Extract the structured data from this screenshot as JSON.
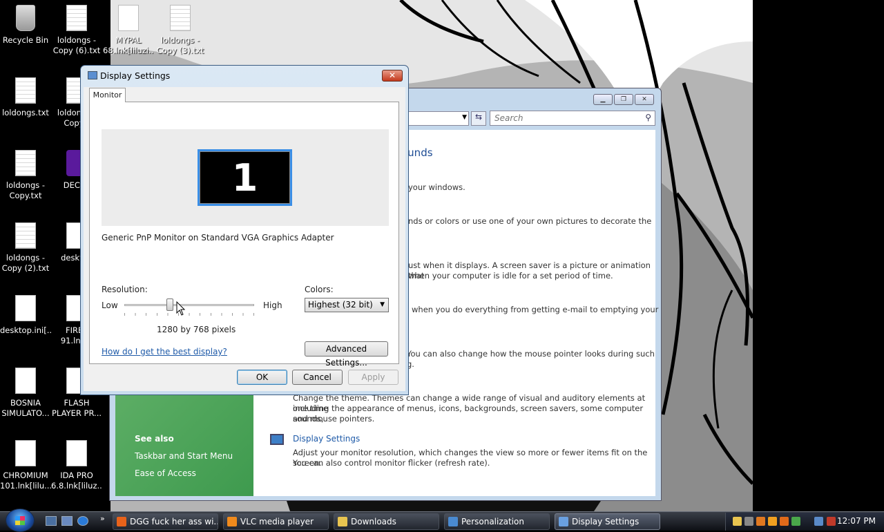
{
  "desktop_icons": [
    {
      "label": "Recycle Bin",
      "kind": "bin"
    },
    {
      "label": "loldongs - Copy (6).txt",
      "kind": "txt"
    },
    {
      "label": "MYPAL 68.lnk[liluzi...",
      "kind": "file"
    },
    {
      "label": "loldongs - Copy (3).txt",
      "kind": "txt"
    },
    {
      "label": "loldongs.txt",
      "kind": "txt"
    },
    {
      "label": "loldongs - Copy (",
      "kind": "txt"
    },
    {
      "label": "loldongs - Copy.txt",
      "kind": "txt"
    },
    {
      "label": "DECRY",
      "kind": "fox"
    },
    {
      "label": "loldongs - Copy (2).txt",
      "kind": "txt"
    },
    {
      "label": "desktop",
      "kind": "file"
    },
    {
      "label": "desktop.ini[...",
      "kind": "file"
    },
    {
      "label": "FIREF 91.lnk[li",
      "kind": "file"
    },
    {
      "label": "BOSNIA SIMULATO...",
      "kind": "file"
    },
    {
      "label": "FLASH PLAYER PR...",
      "kind": "file"
    },
    {
      "label": "CHROMIUM 101.lnk[lilu...",
      "kind": "file"
    },
    {
      "label": "IDA PRO 6.8.lnk[liluz...",
      "kind": "file"
    }
  ],
  "personalization": {
    "search_placeholder": "Search",
    "heading_fragment": "ounds",
    "lines": [
      "your windows.",
      "nds or colors or use one of your own pictures to decorate the",
      "ust when it displays. A screen saver is a picture or animation that",
      "when your computer is idle for a set period of time.",
      "when you do everything from getting e-mail to emptying your",
      "You can also change how the mouse pointer looks during such",
      "g.",
      "Change the theme. Themes can change a wide range of visual and auditory elements at one time",
      "including the appearance of menus, icons, backgrounds, screen savers, some computer sounds,",
      "and mouse pointers."
    ],
    "display_settings_link": "Display Settings",
    "display_settings_desc_1": "Adjust your monitor resolution, which changes the view so more or fewer items fit on the screen.",
    "display_settings_desc_2": "You can also control monitor flicker (refresh rate).",
    "see_also": "See also",
    "see_also_links": [
      "Taskbar and Start Menu",
      "Ease of Access"
    ]
  },
  "dialog": {
    "title": "Display Settings",
    "close_glyph": "✕",
    "tab": "Monitor",
    "monitor_number": "1",
    "adapter": "Generic PnP Monitor on Standard VGA Graphics Adapter",
    "resolution_label": "Resolution:",
    "low": "Low",
    "high": "High",
    "resolution_slider_fraction": 0.35,
    "resolution_text": "1280 by 768 pixels",
    "colors_label": "Colors:",
    "colors_value": "Highest (32 bit)",
    "help_link": "How do I get the best display?",
    "advanced_button": "Advanced Settings...",
    "ok": "OK",
    "cancel": "Cancel",
    "apply": "Apply"
  },
  "taskbar": {
    "tasks": [
      {
        "label": "DGG fuck her ass wi...",
        "color": "#e8621a"
      },
      {
        "label": "VLC media player",
        "color": "#f08a1c"
      },
      {
        "label": "Downloads",
        "color": "#e8c450"
      },
      {
        "label": "Personalization",
        "color": "#4a8ad0"
      },
      {
        "label": "Display Settings",
        "color": "#6aa0e0"
      }
    ],
    "more_glyph": "»",
    "clock": "12:07 PM"
  }
}
